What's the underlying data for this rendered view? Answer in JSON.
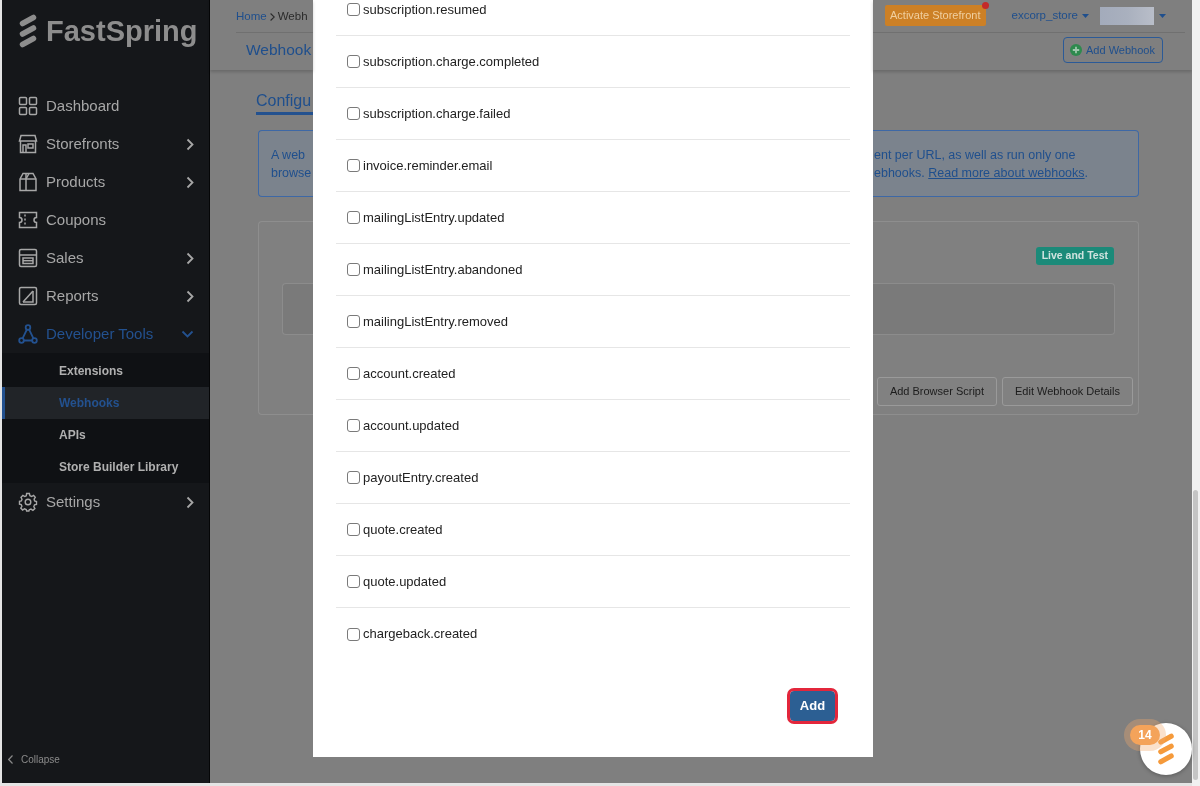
{
  "sidebar": {
    "logo": "FastSpring",
    "items": [
      {
        "label": "Dashboard",
        "kind": "link",
        "selected": false
      },
      {
        "label": "Storefronts",
        "kind": "group",
        "expanded": false,
        "selected": false
      },
      {
        "label": "Products",
        "kind": "group",
        "expanded": false,
        "selected": false
      },
      {
        "label": "Coupons",
        "kind": "link",
        "selected": false
      },
      {
        "label": "Sales",
        "kind": "group",
        "expanded": false,
        "selected": false
      },
      {
        "label": "Reports",
        "kind": "group",
        "expanded": false,
        "selected": false
      },
      {
        "label": "Developer Tools",
        "kind": "group",
        "expanded": true,
        "selected": true,
        "children": [
          {
            "label": "Extensions",
            "selected": false
          },
          {
            "label": "Webhooks",
            "selected": true
          },
          {
            "label": "APIs",
            "selected": false
          },
          {
            "label": "Store Builder Library",
            "selected": false
          }
        ]
      },
      {
        "label": "Settings",
        "kind": "group",
        "expanded": false,
        "selected": false
      }
    ],
    "collapse": "Collapse"
  },
  "header": {
    "breadcrumb": [
      "Home",
      "Webh"
    ],
    "title": "Webhook",
    "activate_button": "Activate Storefront",
    "account": "excorp_store",
    "add_button": "Add Webhook"
  },
  "tabs": [
    {
      "label": "Configu",
      "selected": true
    }
  ],
  "info_banner": {
    "left_lines": [
      "A web",
      "browse"
    ],
    "right_lines": [
      "ent per URL, as well as run only one",
      "ebhooks."
    ],
    "link": "Read more about webhooks",
    "after_link": "."
  },
  "webhook_card": {
    "badge": "Live and Test",
    "buttons": [
      "Add Browser Script",
      "Edit Webhook Details"
    ]
  },
  "modal": {
    "events": [
      {
        "label": "subscription.resumed",
        "checked": false
      },
      {
        "label": "subscription.charge.completed",
        "checked": false
      },
      {
        "label": "subscription.charge.failed",
        "checked": false
      },
      {
        "label": "invoice.reminder.email",
        "checked": false
      },
      {
        "label": "mailingListEntry.updated",
        "checked": false
      },
      {
        "label": "mailingListEntry.abandoned",
        "checked": false
      },
      {
        "label": "mailingListEntry.removed",
        "checked": false
      },
      {
        "label": "account.created",
        "checked": false
      },
      {
        "label": "account.updated",
        "checked": false
      },
      {
        "label": "payoutEntry.created",
        "checked": false
      },
      {
        "label": "quote.created",
        "checked": false
      },
      {
        "label": "quote.updated",
        "checked": false
      },
      {
        "label": "chargeback.created",
        "checked": false
      }
    ],
    "submit_button": "Add"
  },
  "chat_widget": {
    "badge": "14"
  }
}
